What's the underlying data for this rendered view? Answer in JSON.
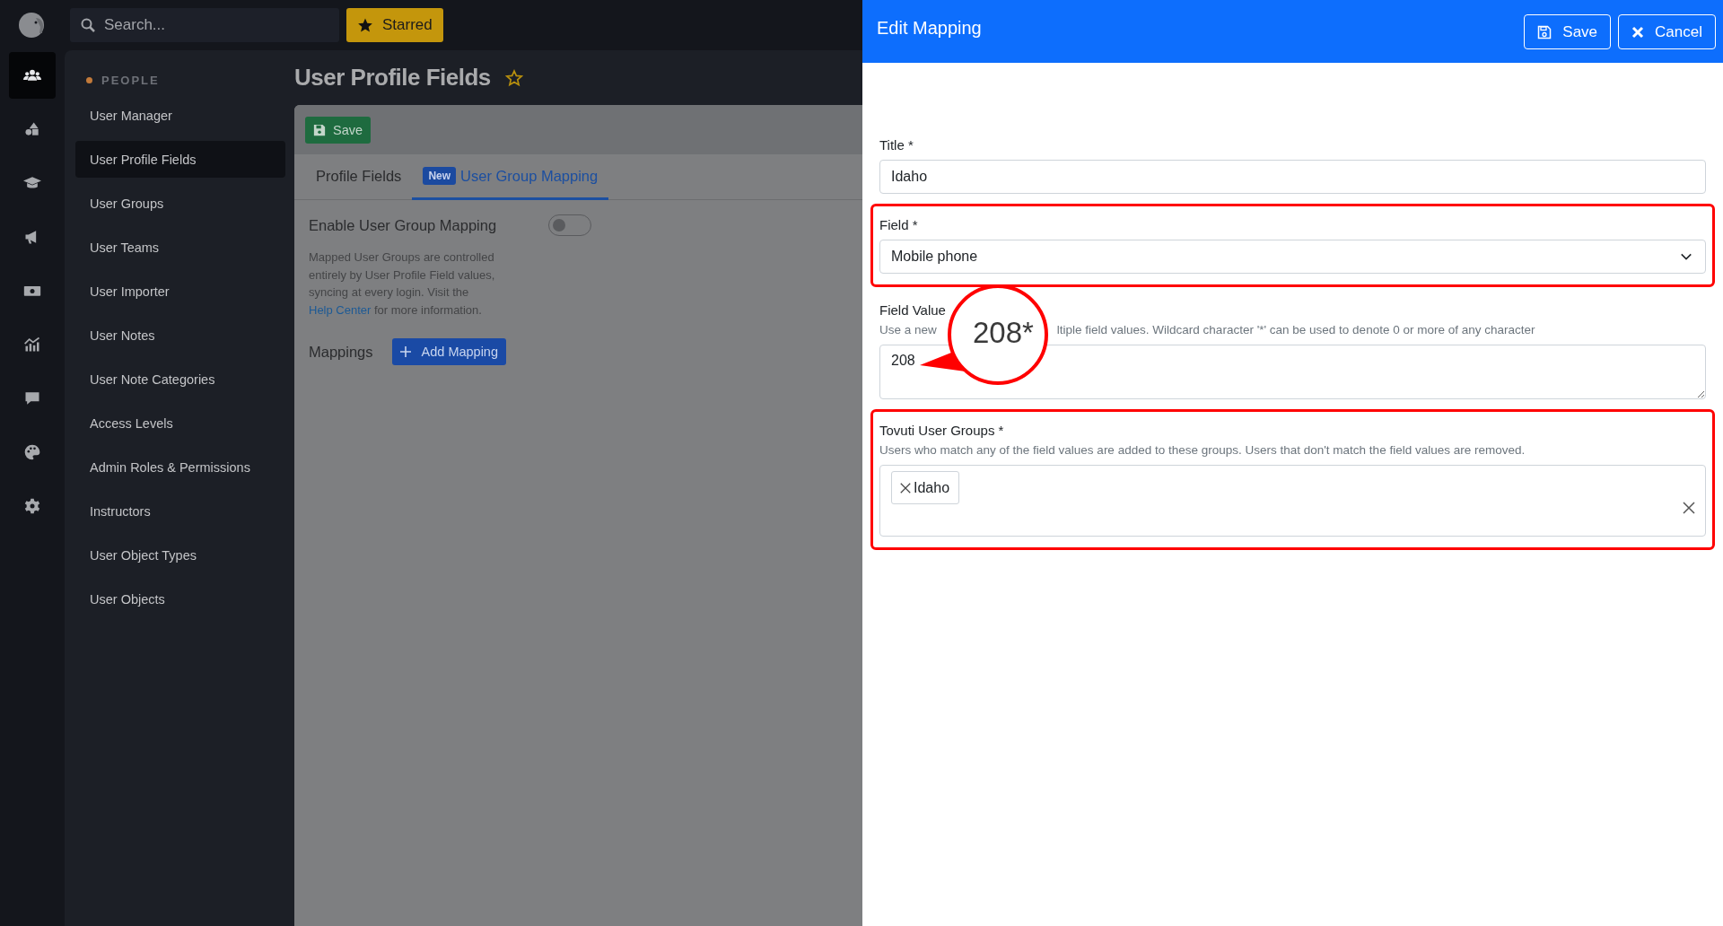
{
  "top_bar": {
    "search": {
      "placeholder": "Search..."
    },
    "starred_button": "Starred"
  },
  "rail": [
    {
      "selected": true
    },
    {
      "selected": false
    },
    {
      "selected": false
    },
    {
      "selected": false
    },
    {
      "selected": false
    },
    {
      "selected": false
    },
    {
      "selected": false
    },
    {
      "selected": false
    },
    {
      "selected": false
    }
  ],
  "sidebar": {
    "section": "PEOPLE",
    "items": [
      {
        "label": "User Manager",
        "selected": false
      },
      {
        "label": "User Profile Fields",
        "selected": true
      },
      {
        "label": "User Groups",
        "selected": false
      },
      {
        "label": "User Teams",
        "selected": false
      },
      {
        "label": "User Importer",
        "selected": false
      },
      {
        "label": "User Notes",
        "selected": false
      },
      {
        "label": "User Note Categories",
        "selected": false
      },
      {
        "label": "Access Levels",
        "selected": false
      },
      {
        "label": "Admin Roles & Permissions",
        "selected": false
      },
      {
        "label": "Instructors",
        "selected": false
      },
      {
        "label": "User Object Types",
        "selected": false
      },
      {
        "label": "User Objects",
        "selected": false
      }
    ]
  },
  "page": {
    "title": "User Profile Fields",
    "save_button": "Save",
    "tabs": [
      {
        "label": "Profile Fields",
        "selected": false
      },
      {
        "badge": "New",
        "label": "User Group Mapping",
        "selected": true
      }
    ],
    "enable": {
      "label": "Enable User Group Mapping",
      "on": false
    },
    "description": {
      "text": "Mapped User Groups are controlled entirely by User Profile Field values, syncing at every login. Visit the",
      "link": "Help Center",
      "text_after": "for more information."
    },
    "mappings": {
      "label": "Mappings",
      "add_button": "Add Mapping"
    }
  },
  "panel": {
    "title": "Edit Mapping",
    "buttons": [
      {
        "kind": "save",
        "label": "Save"
      },
      {
        "kind": "cancel",
        "label": "Cancel"
      }
    ],
    "fields": [
      {
        "kind": "text",
        "label": "Title *",
        "value": "Idaho",
        "highlighted": false
      },
      {
        "kind": "select",
        "label": "Field *",
        "value": "Mobile phone",
        "highlighted": true
      },
      {
        "kind": "textarea",
        "label": "Field Value",
        "hint_parts": [
          "Use a new",
          "ltiple field values. Wildcard character '*' can be used to denote 0 or more of any character"
        ],
        "value": "208",
        "magnified": "208*",
        "highlighted": false
      },
      {
        "kind": "tags",
        "label": "Tovuti User Groups *",
        "hint": "Users who match any of the field values are added to these groups. Users that don't match the field values are removed.",
        "tags": [
          "Idaho"
        ],
        "highlighted": true
      }
    ]
  }
}
